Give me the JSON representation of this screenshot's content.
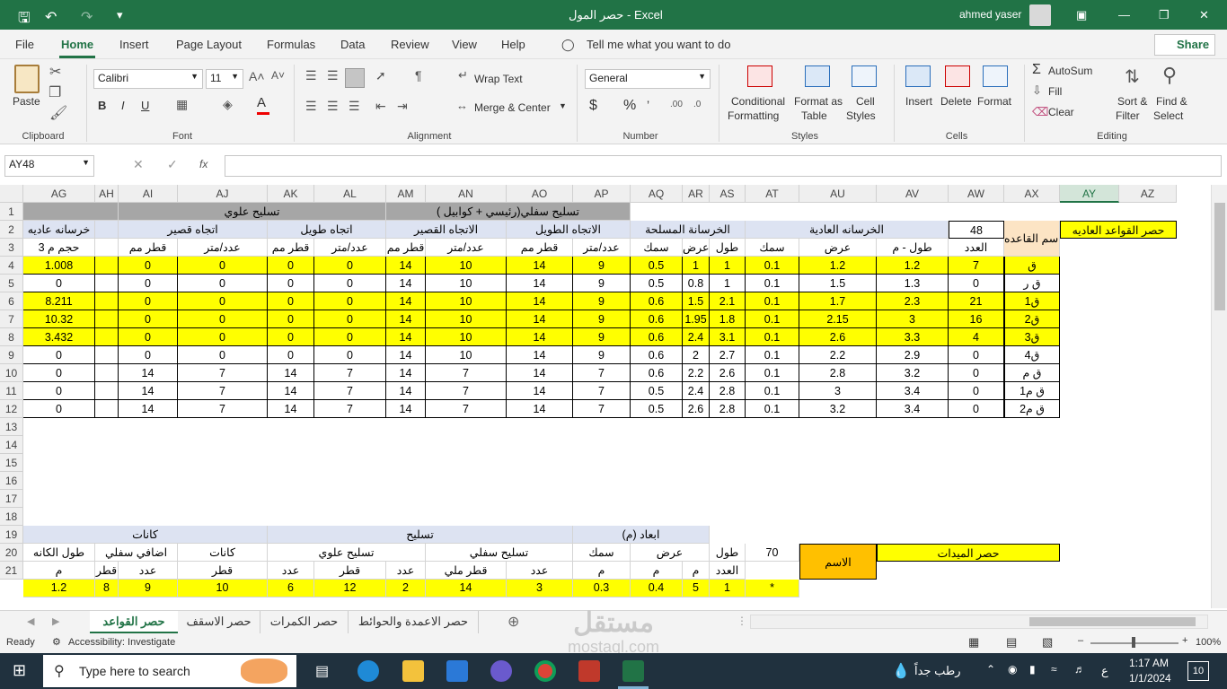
{
  "title": {
    "doc": "حصر المول",
    "app": "Excel",
    "user": "ahmed yaser",
    "separator": "-"
  },
  "menu": [
    "File",
    "Home",
    "Insert",
    "Page Layout",
    "Formulas",
    "Data",
    "Review",
    "View",
    "Help"
  ],
  "tell_me": "Tell me what you want to do",
  "share": "Share",
  "ribbon": {
    "clipboard": {
      "paste": "Paste",
      "label": "Clipboard"
    },
    "font": {
      "name": "Calibri",
      "size": "11",
      "label": "Font"
    },
    "alignment": {
      "wrap": "Wrap Text",
      "merge": "Merge & Center",
      "label": "Alignment"
    },
    "number": {
      "format": "General",
      "label": "Number"
    },
    "styles": {
      "cond1": "Conditional",
      "cond2": "Formatting",
      "fmt1": "Format as",
      "fmt2": "Table",
      "cell1": "Cell",
      "cell2": "Styles",
      "label": "Styles"
    },
    "cells": {
      "insert": "Insert",
      "delete": "Delete",
      "format": "Format",
      "label": "Cells"
    },
    "editing": {
      "autosum": "AutoSum",
      "fill": "Fill",
      "clear": "Clear",
      "sort1": "Sort &",
      "sort2": "Filter",
      "find1": "Find &",
      "find2": "Select",
      "label": "Editing"
    }
  },
  "namebox": "AY48",
  "fx": "fx",
  "columns": [
    "AG",
    "AH",
    "AI",
    "AJ",
    "AK",
    "AL",
    "AM",
    "AN",
    "AO",
    "AP",
    "AQ",
    "AR",
    "AS",
    "AT",
    "AU",
    "AV",
    "AW",
    "AX",
    "AY",
    "AZ"
  ],
  "rows": [
    "1",
    "2",
    "3",
    "4",
    "5",
    "6",
    "7",
    "8",
    "9",
    "10",
    "11",
    "12",
    "13",
    "14",
    "15",
    "16",
    "17",
    "18",
    "19",
    "20",
    "21"
  ],
  "sheet": {
    "r1": {
      "upper": "تسليح علوي",
      "lower": "تسليح سفلي(رئيسي + كوابيل )"
    },
    "r2": {
      "concrete": "خرسانه عاديه",
      "short_dir": "اتجاه قصير",
      "long_dir": "اتجاه طويل",
      "short_dir2": "الاتجاه القصير",
      "long_dir2": "الاتجاه الطويل",
      "reinforced": "الخرسانة المسلحة",
      "plain": "الخرسانه العادية",
      "count_val": "48",
      "base_name": "اسم القاعده",
      "title": "حصر القواعد العاديه"
    },
    "r3": [
      "حجم م 3",
      "",
      "قطر مم",
      "عدد/متر",
      "قطر مم",
      "عدد/متر",
      "قطر مم",
      "عدد/متر",
      "قطر مم",
      "عدد/متر",
      "سمك",
      "عرض",
      "طول",
      "سمك",
      "عرض",
      "طول - م",
      "العدد",
      ""
    ],
    "data": [
      {
        "y": true,
        "v": [
          "1.008",
          "",
          "0",
          "0",
          "0",
          "0",
          "14",
          "10",
          "14",
          "9",
          "0.5",
          "1",
          "1",
          "0.1",
          "1.2",
          "1.2",
          "7",
          "ق"
        ]
      },
      {
        "y": false,
        "v": [
          "0",
          "",
          "0",
          "0",
          "0",
          "0",
          "14",
          "10",
          "14",
          "9",
          "0.5",
          "0.8",
          "1",
          "0.1",
          "1.5",
          "1.3",
          "0",
          "ق ر"
        ]
      },
      {
        "y": true,
        "v": [
          "8.211",
          "",
          "0",
          "0",
          "0",
          "0",
          "14",
          "10",
          "14",
          "9",
          "0.6",
          "1.5",
          "2.1",
          "0.1",
          "1.7",
          "2.3",
          "21",
          "ق1"
        ]
      },
      {
        "y": true,
        "v": [
          "10.32",
          "",
          "0",
          "0",
          "0",
          "0",
          "14",
          "10",
          "14",
          "9",
          "0.6",
          "1.95",
          "1.8",
          "0.1",
          "2.15",
          "3",
          "16",
          "ق2"
        ]
      },
      {
        "y": true,
        "v": [
          "3.432",
          "",
          "0",
          "0",
          "0",
          "0",
          "14",
          "10",
          "14",
          "9",
          "0.6",
          "2.4",
          "3.1",
          "0.1",
          "2.6",
          "3.3",
          "4",
          "ق3"
        ]
      },
      {
        "y": false,
        "v": [
          "0",
          "",
          "0",
          "0",
          "0",
          "0",
          "14",
          "10",
          "14",
          "9",
          "0.6",
          "2",
          "2.7",
          "0.1",
          "2.2",
          "2.9",
          "0",
          "ق4"
        ]
      },
      {
        "y": false,
        "v": [
          "0",
          "",
          "14",
          "7",
          "14",
          "7",
          "14",
          "7",
          "14",
          "7",
          "0.6",
          "2.2",
          "2.6",
          "0.1",
          "2.8",
          "3.2",
          "0",
          "ق م"
        ]
      },
      {
        "y": false,
        "v": [
          "0",
          "",
          "14",
          "7",
          "14",
          "7",
          "14",
          "7",
          "14",
          "7",
          "0.5",
          "2.4",
          "2.8",
          "0.1",
          "3",
          "3.4",
          "0",
          "ق م1"
        ]
      },
      {
        "y": false,
        "v": [
          "0",
          "",
          "14",
          "7",
          "14",
          "7",
          "14",
          "7",
          "14",
          "7",
          "0.5",
          "2.6",
          "2.8",
          "0.1",
          "3.2",
          "3.4",
          "0",
          "ق م2"
        ]
      }
    ],
    "r19": {
      "ties": "كانات",
      "rebar": "تسليح",
      "dims": "ابعاد (م)"
    },
    "r20": {
      "tie_len": "طول الكانه",
      "extra_bottom": "اضافي سفلي",
      "ties": "كانات",
      "upper": "تسليح علوي",
      "lower": "تسليح سفلي",
      "thick": "سمك",
      "width": "عرض",
      "length": "طول",
      "count": "70",
      "name": "الاسم",
      "title": "حصر الميدات"
    },
    "r21": [
      "م",
      "قطر",
      "عدد",
      "قطر",
      "عدد",
      "قطر",
      "عدد",
      "قطر ملي",
      "عدد",
      "م",
      "م",
      "م",
      "العدد"
    ],
    "r22": [
      "1.2",
      "8",
      "9",
      "10",
      "6",
      "12",
      "2",
      "14",
      "3",
      "0.3",
      "0.4",
      "5",
      "1",
      "*"
    ]
  },
  "tabs": [
    "حصر القواعد",
    "حصر الاسقف",
    "حصر الكمرات",
    "حصر الاعمدة والحوائط"
  ],
  "status": {
    "ready": "Ready",
    "access": "Accessibility: Investigate",
    "zoom": "100%"
  },
  "taskbar": {
    "search": "Type here to search",
    "weather": "رطب جداً",
    "lang": "ع",
    "time": "1:17 AM",
    "date": "1/1/2024",
    "notif": "10"
  },
  "watermark": {
    "ar": "مستقل",
    "en": "mostaql.com"
  },
  "colors": {
    "excel_green": "#217346",
    "yellow": "#ffff00",
    "gray_header": "#a6a6a6",
    "lavender": "#dde3f2",
    "orange": "#ffc000",
    "peach": "#fce4c4"
  }
}
